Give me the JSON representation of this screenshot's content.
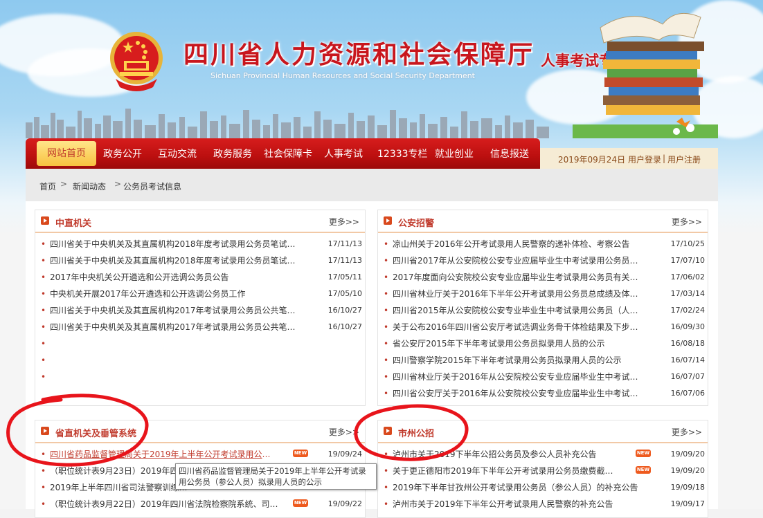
{
  "header": {
    "title": "四川省人力资源和社会保障厅",
    "subtitle": "Sichuan Provincial Human Resources and Social Security Department",
    "section": "人事考试专栏"
  },
  "nav": {
    "items": [
      "网站首页",
      "政务公开",
      "互动交流",
      "政务服务",
      "社会保障卡",
      "人事考试",
      "12333专栏",
      "就业创业",
      "信息报送"
    ],
    "date": "2019年09月24日",
    "login": "用户登录",
    "separator": "|",
    "register": "用户注册"
  },
  "breadcrumb": [
    "首页",
    "新闻动态",
    "公务员考试信息"
  ],
  "breadcrumb_sep": ">",
  "panels": {
    "central": {
      "title": "中直机关",
      "more": "更多>>",
      "rows": [
        {
          "title": "四川省关于中央机关及其直属机构2018年度考试录用公务员笔试…",
          "date": "17/11/13"
        },
        {
          "title": "四川省关于中央机关及其直属机构2018年度考试录用公务员笔试…",
          "date": "17/11/13"
        },
        {
          "title": "2017年中央机关公开遴选和公开选调公务员公告",
          "date": "17/05/11"
        },
        {
          "title": "中央机关开展2017年公开遴选和公开选调公务员工作",
          "date": "17/05/10"
        },
        {
          "title": "四川省关于中央机关及其直属机构2017年考试录用公务员公共笔…",
          "date": "16/10/27"
        },
        {
          "title": "四川省关于中央机关及其直属机构2017年考试录用公务员公共笔…",
          "date": "16/10/27"
        }
      ],
      "empty_dots": 3
    },
    "police": {
      "title": "公安招警",
      "more": "更多>>",
      "rows": [
        {
          "title": "凉山州关于2016年公开考试录用人民警察的递补体检、考察公告",
          "date": "17/10/25"
        },
        {
          "title": "四川省2017年从公安院校公安专业应届毕业生中考试录用公务员…",
          "date": "17/07/10"
        },
        {
          "title": "2017年度面向公安院校公安专业应届毕业生考试录用公务员有关…",
          "date": "17/06/02"
        },
        {
          "title": "四川省林业厅关于2016年下半年公开考试录用公务员总成绩及体…",
          "date": "17/03/14"
        },
        {
          "title": "四川省2015年从公安院校公安专业毕业生中考试录用公务员（人…",
          "date": "17/02/24"
        },
        {
          "title": "关于公布2016年四川省公安厅考试选调业务骨干体检结果及下步…",
          "date": "16/09/30"
        },
        {
          "title": "省公安厅2015年下半年考试录用公务员拟录用人员的公示",
          "date": "16/08/18"
        },
        {
          "title": "四川警察学院2015年下半年考试录用公务员拟录用人员的公示",
          "date": "16/07/14"
        },
        {
          "title": "四川省林业厅关于2016年从公安院校公安专业应届毕业生中考试…",
          "date": "16/07/07"
        },
        {
          "title": "四川省公安厅关于2016年从公安院校公安专业应届毕业生中考试…",
          "date": "16/07/06"
        }
      ]
    },
    "provincial": {
      "title": "省直机关及垂管系统",
      "more": "更多>>",
      "rows": [
        {
          "title": "四川省药品监督管理局关于2019年上半年公开考试录用公务员（…",
          "date": "19/09/24",
          "new": true
        },
        {
          "title": "（职位统计表9月23日）2019年四川…",
          "date": "",
          "new": false
        },
        {
          "title": "2019年上半年四川省司法警察训练…",
          "date": "",
          "new": false
        },
        {
          "title": "（职位统计表9月22日）2019年四川省法院检察院系统、司法机…",
          "date": "19/09/22",
          "new": true
        }
      ]
    },
    "city": {
      "title": "市州公招",
      "more": "更多>>",
      "rows": [
        {
          "title": "泸州市关于2019下半年公招公务员及参公人员补充公告",
          "date": "19/09/20",
          "new": true
        },
        {
          "title": "关于更正德阳市2019年下半年公开考试录用公务员缴费截止时间…",
          "date": "19/09/20",
          "new": true
        },
        {
          "title": "2019年下半年甘孜州公开考试录用公务员（参公人员）的补充公告",
          "date": "19/09/18",
          "new": false
        },
        {
          "title": "泸州市关于2019年下半年公开考试录用人民警察的补充公告",
          "date": "19/09/17",
          "new": false
        }
      ]
    }
  },
  "tooltip": "四川省药品监督管理局关于2019年上半年公开考试录用公务员（参公人员）拟录用人员的公示",
  "new_badge": "NEW",
  "colors": {
    "brand_red": "#c8161d",
    "nav_red": "#bb0f0f",
    "annotation_red": "#e8141b"
  }
}
